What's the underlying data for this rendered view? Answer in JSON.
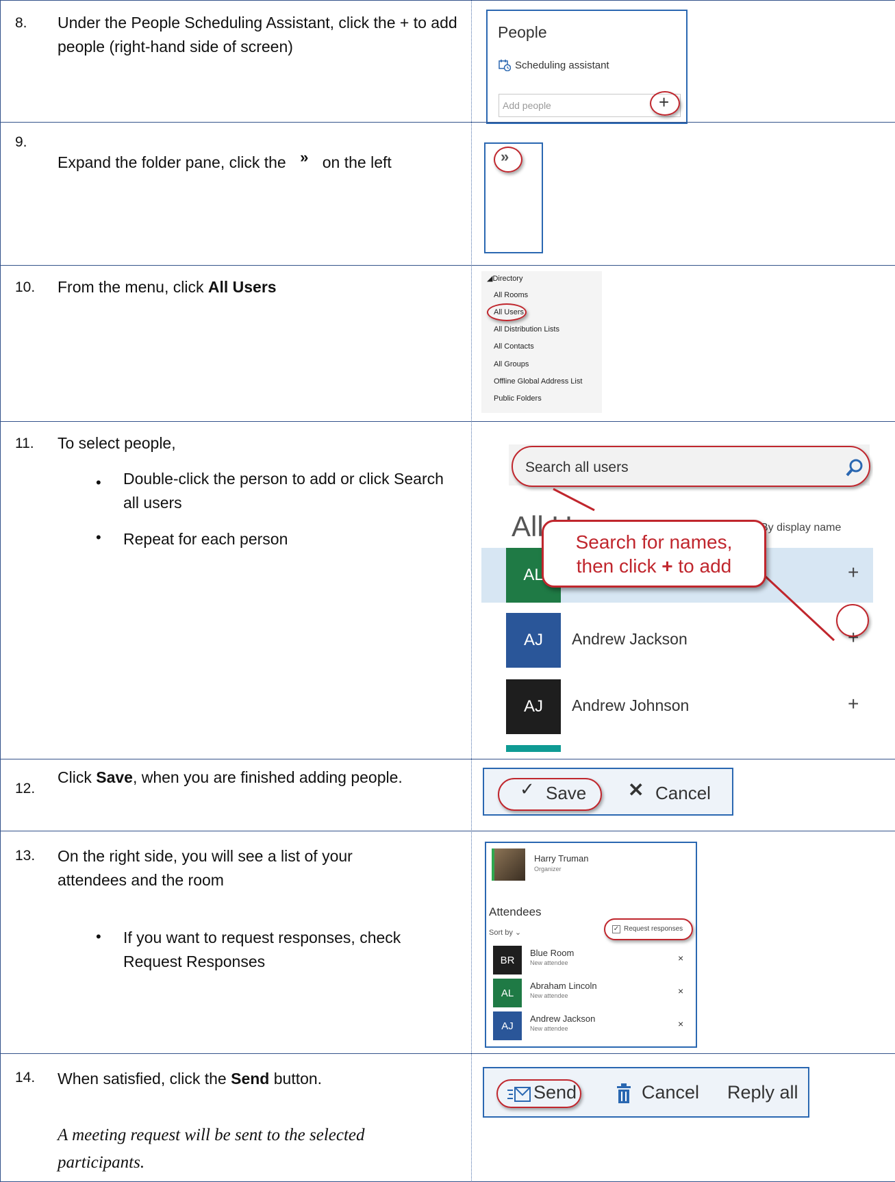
{
  "steps": [
    {
      "num": "8.",
      "text": "Under the People Scheduling Assistant, click the + to add people (right-hand side of screen)"
    },
    {
      "num": "9.",
      "text_before": "Expand the folder pane, click the",
      "icon": "»",
      "text_after": "on the left"
    },
    {
      "num": "10.",
      "text_before": "From the menu, click ",
      "bold": "All Users"
    },
    {
      "num": "11.",
      "text": "To select people,",
      "bullets": [
        "Double-click the person to add or click Search all users",
        "Repeat for each person"
      ]
    },
    {
      "num": "12.",
      "text_before": "Click ",
      "bold": "Save",
      "text_after": ", when you are finished adding people."
    },
    {
      "num": "13.",
      "text": "On the right side, you will see a list of your attendees and the room",
      "bullets": [
        "If you want to request responses, check Request Responses"
      ]
    },
    {
      "num": "14.",
      "text_before": "When satisfied, click the ",
      "bold": "Send",
      "text_after": " button.",
      "note": "A meeting request will be sent to the selected participants."
    }
  ],
  "shot8": {
    "title": "People",
    "scheduling": "Scheduling assistant",
    "placeholder": "Add people",
    "plus": "+"
  },
  "shot9": {
    "expand": "»"
  },
  "shot10": {
    "header": "Directory",
    "items": [
      "All Rooms",
      "All Users",
      "All Distribution Lists",
      "All Contacts",
      "All Groups",
      "Offline Global Address List",
      "Public Folders"
    ]
  },
  "shot11": {
    "search_placeholder": "Search all users",
    "heading": "All Users",
    "sort": "By display name",
    "callout_line1": "Search for names,",
    "callout_pre": "then click ",
    "callout_plus": "+",
    "callout_post": " to add",
    "users": [
      {
        "initials": "AL",
        "name": "",
        "color": "#1f7a45"
      },
      {
        "initials": "AJ",
        "name": "Andrew Jackson",
        "color": "#2a5699"
      },
      {
        "initials": "AJ",
        "name": "Andrew Johnson",
        "color": "#1e1e1e"
      }
    ]
  },
  "shot12": {
    "save": "Save",
    "cancel": "Cancel"
  },
  "shot13": {
    "organizer_name": "Harry Truman",
    "organizer_role": "Organizer",
    "attendees_label": "Attendees",
    "sort_by": "Sort by",
    "request_responses": "Request responses",
    "attendees": [
      {
        "initials": "BR",
        "name": "Blue Room",
        "status": "New attendee",
        "color": "#1e1e1e"
      },
      {
        "initials": "AL",
        "name": "Abraham Lincoln",
        "status": "New attendee",
        "color": "#1f7a45"
      },
      {
        "initials": "AJ",
        "name": "Andrew Jackson",
        "status": "New attendee",
        "color": "#2a5699"
      }
    ]
  },
  "shot14": {
    "send": "Send",
    "cancel": "Cancel",
    "reply_all": "Reply all"
  },
  "colors": {
    "frame": "#2a67b1",
    "highlight": "#c0262d",
    "rule": "#33528a"
  }
}
